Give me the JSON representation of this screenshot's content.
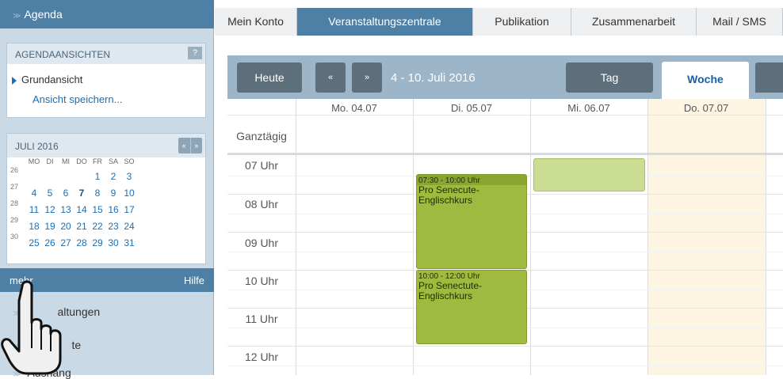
{
  "sidebar": {
    "title": "Agenda",
    "views_header": "AGENDAANSICHTEN",
    "help_badge": "?",
    "views": [
      "Grundansicht"
    ],
    "save_view_link": "Ansicht speichern...",
    "calendar": {
      "month_label": "JULI 2016",
      "weekdays": [
        "MO",
        "DI",
        "MI",
        "DO",
        "FR",
        "SA",
        "SO"
      ],
      "weeks": [
        {
          "wk": "26",
          "days": [
            "",
            "",
            "",
            "",
            "1",
            "2",
            "3"
          ]
        },
        {
          "wk": "27",
          "days": [
            "4",
            "5",
            "6",
            "7",
            "8",
            "9",
            "10"
          ]
        },
        {
          "wk": "28",
          "days": [
            "11",
            "12",
            "13",
            "14",
            "15",
            "16",
            "17"
          ]
        },
        {
          "wk": "29",
          "days": [
            "18",
            "19",
            "20",
            "21",
            "22",
            "23",
            "24"
          ]
        },
        {
          "wk": "30",
          "days": [
            "25",
            "26",
            "27",
            "28",
            "29",
            "30",
            "31"
          ]
        }
      ],
      "highlighted_day": "7"
    },
    "mehr_label": "mehr",
    "hilfe_label": "Hilfe",
    "sections": [
      "Veranstaltungen",
      "Liste",
      "Aushang"
    ],
    "sections_visible": [
      "altungen",
      "te",
      "Aushang"
    ]
  },
  "top_tabs": [
    {
      "label": "Mein Konto",
      "active": false
    },
    {
      "label": "Veranstaltungszentrale",
      "active": true
    },
    {
      "label": "Publikation",
      "active": false
    },
    {
      "label": "Zusammenarbeit",
      "active": false
    },
    {
      "label": "Mail / SMS",
      "active": false
    }
  ],
  "toolbar": {
    "today_button": "Heute",
    "prev_icon": "«",
    "next_icon": "»",
    "range_label": "4 - 10. Juli 2016",
    "view_tabs": [
      {
        "label": "Tag",
        "active": false
      },
      {
        "label": "Woche",
        "active": true
      }
    ]
  },
  "week": {
    "days": [
      "Mo. 04.07",
      "Di. 05.07",
      "Mi. 06.07",
      "Do. 07.07"
    ],
    "allday_label": "Ganztägig",
    "hours": [
      "07 Uhr",
      "08 Uhr",
      "09 Uhr",
      "10 Uhr",
      "11 Uhr",
      "12 Uhr"
    ],
    "events": [
      {
        "time": "07:30 - 10:00 Uhr",
        "title": "Pro Senecute- Englischkurs"
      },
      {
        "time": "10:00 - 12:00 Uhr",
        "title": "Pro Senectute- Englischkurs"
      }
    ]
  },
  "colors": {
    "header_blue": "#4e7fa5",
    "sidebar_bg": "#c9d9e5",
    "event_green": "#9fba3f",
    "today_highlight": "#fdf5e1",
    "link_blue": "#1b6fb3"
  }
}
